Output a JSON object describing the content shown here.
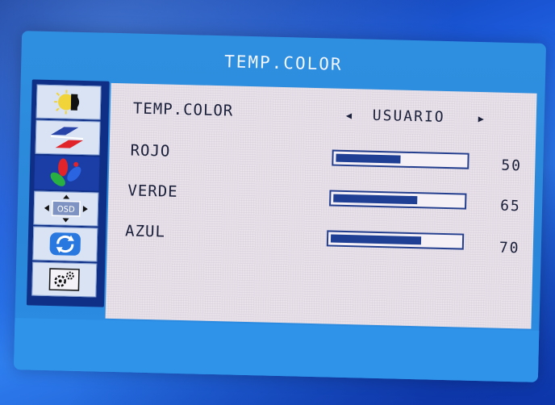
{
  "osd": {
    "title": "TEMP.COLOR",
    "menu_icons": [
      "brightness-contrast-icon",
      "picture-image-icon",
      "color-rgb-icon",
      "osd-position-icon",
      "reset-icon",
      "settings-gears-icon"
    ],
    "selected_menu": "color-rgb-icon",
    "osd_icon_text": "OSD",
    "rows": {
      "temp_color": {
        "label": "TEMP.COLOR",
        "value": "USUARIO",
        "left_arrow": "◀",
        "right_arrow": "▶"
      },
      "red": {
        "label": "ROJO",
        "value": "50",
        "level_percent": 50
      },
      "green": {
        "label": "VERDE",
        "value": "65",
        "level_percent": 65
      },
      "blue": {
        "label": "AZUL",
        "value": "70",
        "level_percent": 70
      }
    },
    "colors": {
      "accent": "#2e8fe0",
      "bar": "#1e3f94",
      "sidebar": "#0f2f86"
    }
  }
}
